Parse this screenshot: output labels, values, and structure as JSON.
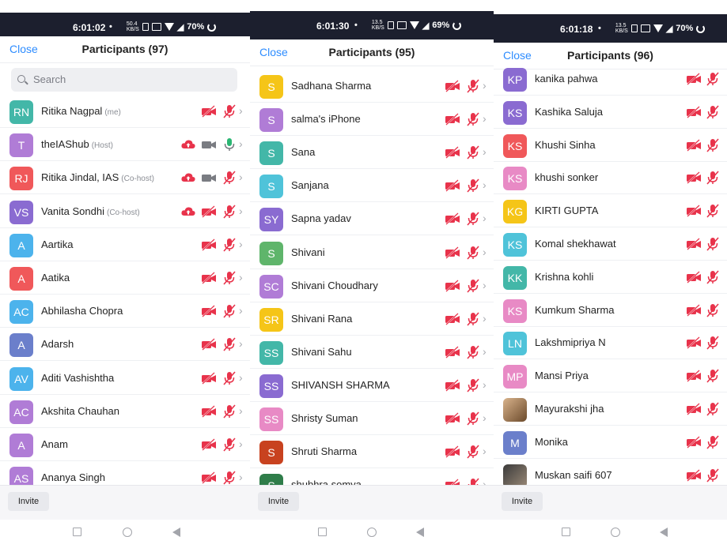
{
  "colors": {
    "accent": "#2d8cff",
    "muted_red": "#e8334b",
    "unmuted_green": "#2bb673",
    "statusbar": "#1c1f2e"
  },
  "screens": [
    {
      "status": {
        "time": "6:01:02",
        "dot": "•",
        "speed": "50.4",
        "speed_unit": "KB/S",
        "battery": "70%"
      },
      "header": {
        "close": "Close",
        "title": "Participants (97)"
      },
      "search": {
        "placeholder": "Search"
      },
      "invite": "Invite",
      "participants": [
        {
          "initials": "RN",
          "name": "Ritika Nagpal",
          "role": "(me)",
          "color": "#43b7a8",
          "cloud": false,
          "video": "off",
          "audio": "muted",
          "chevron": true
        },
        {
          "initials": "T",
          "name": "theIAShub",
          "role": "(Host)",
          "color": "#b07cd6",
          "cloud": true,
          "video": "on",
          "audio": "on",
          "chevron": true
        },
        {
          "initials": "RJ",
          "name": "Ritika Jindal, IAS",
          "role": "(Co-host)",
          "color": "#f0585a",
          "cloud": true,
          "video": "on",
          "audio": "muted",
          "chevron": true
        },
        {
          "initials": "VS",
          "name": "Vanita Sondhi",
          "role": "(Co-host)",
          "color": "#8a6bd1",
          "cloud": true,
          "video": "off",
          "audio": "muted",
          "chevron": true
        },
        {
          "initials": "A",
          "name": "Aartika",
          "role": "",
          "color": "#4cb3ec",
          "cloud": false,
          "video": "off",
          "audio": "muted",
          "chevron": true
        },
        {
          "initials": "A",
          "name": "Aatika",
          "role": "",
          "color": "#f0585a",
          "cloud": false,
          "video": "off",
          "audio": "muted",
          "chevron": true
        },
        {
          "initials": "AC",
          "name": "Abhilasha Chopra",
          "role": "",
          "color": "#4cb3ec",
          "cloud": false,
          "video": "off",
          "audio": "muted",
          "chevron": true
        },
        {
          "initials": "A",
          "name": "Adarsh",
          "role": "",
          "color": "#6b7fcb",
          "cloud": false,
          "video": "off",
          "audio": "muted",
          "chevron": true
        },
        {
          "initials": "AV",
          "name": "Aditi Vashishtha",
          "role": "",
          "color": "#4cb3ec",
          "cloud": false,
          "video": "off",
          "audio": "muted",
          "chevron": true
        },
        {
          "initials": "AC",
          "name": "Akshita Chauhan",
          "role": "",
          "color": "#b07cd6",
          "cloud": false,
          "video": "off",
          "audio": "muted",
          "chevron": true
        },
        {
          "initials": "A",
          "name": "Anam",
          "role": "",
          "color": "#b07cd6",
          "cloud": false,
          "video": "off",
          "audio": "muted",
          "chevron": true
        },
        {
          "initials": "AS",
          "name": "Ananya Singh",
          "role": "",
          "color": "#b07cd6",
          "cloud": false,
          "video": "off",
          "audio": "muted",
          "chevron": true
        }
      ]
    },
    {
      "status": {
        "time": "6:01:30",
        "dot": "•",
        "speed": "13.5",
        "speed_unit": "KB/S",
        "battery": "69%"
      },
      "header": {
        "close": "Close",
        "title": "Participants (95)"
      },
      "invite": "Invite",
      "participants": [
        {
          "initials": "S",
          "name": "Sadhana Sharma",
          "role": "",
          "color": "#f5c518",
          "cloud": false,
          "video": "off",
          "audio": "muted",
          "chevron": true
        },
        {
          "initials": "S",
          "name": "salma's iPhone",
          "role": "",
          "color": "#b07cd6",
          "cloud": false,
          "video": "off",
          "audio": "muted",
          "chevron": true
        },
        {
          "initials": "S",
          "name": "Sana",
          "role": "",
          "color": "#43b7a8",
          "cloud": false,
          "video": "off",
          "audio": "muted",
          "chevron": true
        },
        {
          "initials": "S",
          "name": "Sanjana",
          "role": "",
          "color": "#4fc3d9",
          "cloud": false,
          "video": "off",
          "audio": "muted",
          "chevron": true
        },
        {
          "initials": "SY",
          "name": "Sapna yadav",
          "role": "",
          "color": "#8a6bd1",
          "cloud": false,
          "video": "off",
          "audio": "muted",
          "chevron": true
        },
        {
          "initials": "S",
          "name": "Shivani",
          "role": "",
          "color": "#5fb56b",
          "cloud": false,
          "video": "off",
          "audio": "muted",
          "chevron": true
        },
        {
          "initials": "SC",
          "name": "Shivani Choudhary",
          "role": "",
          "color": "#b07cd6",
          "cloud": false,
          "video": "off",
          "audio": "muted",
          "chevron": true
        },
        {
          "initials": "SR",
          "name": "Shivani Rana",
          "role": "",
          "color": "#f5c518",
          "cloud": false,
          "video": "off",
          "audio": "muted",
          "chevron": true
        },
        {
          "initials": "SS",
          "name": "Shivani Sahu",
          "role": "",
          "color": "#43b7a8",
          "cloud": false,
          "video": "off",
          "audio": "muted",
          "chevron": true
        },
        {
          "initials": "SS",
          "name": "SHIVANSH SHARMA",
          "role": "",
          "color": "#8a6bd1",
          "cloud": false,
          "video": "off",
          "audio": "muted",
          "chevron": true
        },
        {
          "initials": "SS",
          "name": "Shristy Suman",
          "role": "",
          "color": "#e88ac5",
          "cloud": false,
          "video": "off",
          "audio": "muted",
          "chevron": true
        },
        {
          "initials": "S",
          "name": "Shruti Sharma",
          "role": "",
          "color": "#c8421f",
          "cloud": false,
          "video": "off",
          "audio": "muted",
          "chevron": true
        },
        {
          "initials": "S",
          "name": "shubhra somya",
          "role": "",
          "color": "#2f7d4a",
          "cloud": false,
          "video": "off",
          "audio": "muted",
          "chevron": true
        }
      ]
    },
    {
      "status": {
        "time": "6:01:18",
        "dot": "•",
        "speed": "13.5",
        "speed_unit": "KB/S",
        "battery": "70%"
      },
      "header": {
        "close": "Close",
        "title": "Participants (96)"
      },
      "invite": "Invite",
      "participants": [
        {
          "initials": "KP",
          "name": "kanika pahwa",
          "role": "",
          "color": "#8a6bd1",
          "cloud": false,
          "video": "off",
          "audio": "muted",
          "chevron": false
        },
        {
          "initials": "KS",
          "name": "Kashika Saluja",
          "role": "",
          "color": "#8a6bd1",
          "cloud": false,
          "video": "off",
          "audio": "muted",
          "chevron": false
        },
        {
          "initials": "KS",
          "name": "Khushi Sinha",
          "role": "",
          "color": "#f0585a",
          "cloud": false,
          "video": "off",
          "audio": "muted",
          "chevron": false
        },
        {
          "initials": "KS",
          "name": "khushi sonker",
          "role": "",
          "color": "#e88ac5",
          "cloud": false,
          "video": "off",
          "audio": "muted",
          "chevron": false
        },
        {
          "initials": "KG",
          "name": "KIRTI GUPTA",
          "role": "",
          "color": "#f5c518",
          "cloud": false,
          "video": "off",
          "audio": "muted",
          "chevron": false
        },
        {
          "initials": "KS",
          "name": "Komal shekhawat",
          "role": "",
          "color": "#4fc3d9",
          "cloud": false,
          "video": "off",
          "audio": "muted",
          "chevron": false
        },
        {
          "initials": "KK",
          "name": "Krishna kohli",
          "role": "",
          "color": "#43b7a8",
          "cloud": false,
          "video": "off",
          "audio": "muted",
          "chevron": false
        },
        {
          "initials": "KS",
          "name": "Kumkum Sharma",
          "role": "",
          "color": "#e88ac5",
          "cloud": false,
          "video": "off",
          "audio": "muted",
          "chevron": false
        },
        {
          "initials": "LN",
          "name": "Lakshmipriya N",
          "role": "",
          "color": "#4fc3d9",
          "cloud": false,
          "video": "off",
          "audio": "muted",
          "chevron": false
        },
        {
          "initials": "MP",
          "name": "Mansi Priya",
          "role": "",
          "color": "#e88ac5",
          "cloud": false,
          "video": "off",
          "audio": "muted",
          "chevron": false
        },
        {
          "initials": "",
          "name": "Mayurakshi jha",
          "role": "",
          "color": "photo",
          "cloud": false,
          "video": "off",
          "audio": "muted",
          "chevron": false
        },
        {
          "initials": "M",
          "name": "Monika",
          "role": "",
          "color": "#6b7fcb",
          "cloud": false,
          "video": "off",
          "audio": "muted",
          "chevron": false
        },
        {
          "initials": "",
          "name": "Muskan saifi 607",
          "role": "",
          "color": "photo2",
          "cloud": false,
          "video": "off",
          "audio": "muted",
          "chevron": false
        }
      ]
    }
  ]
}
